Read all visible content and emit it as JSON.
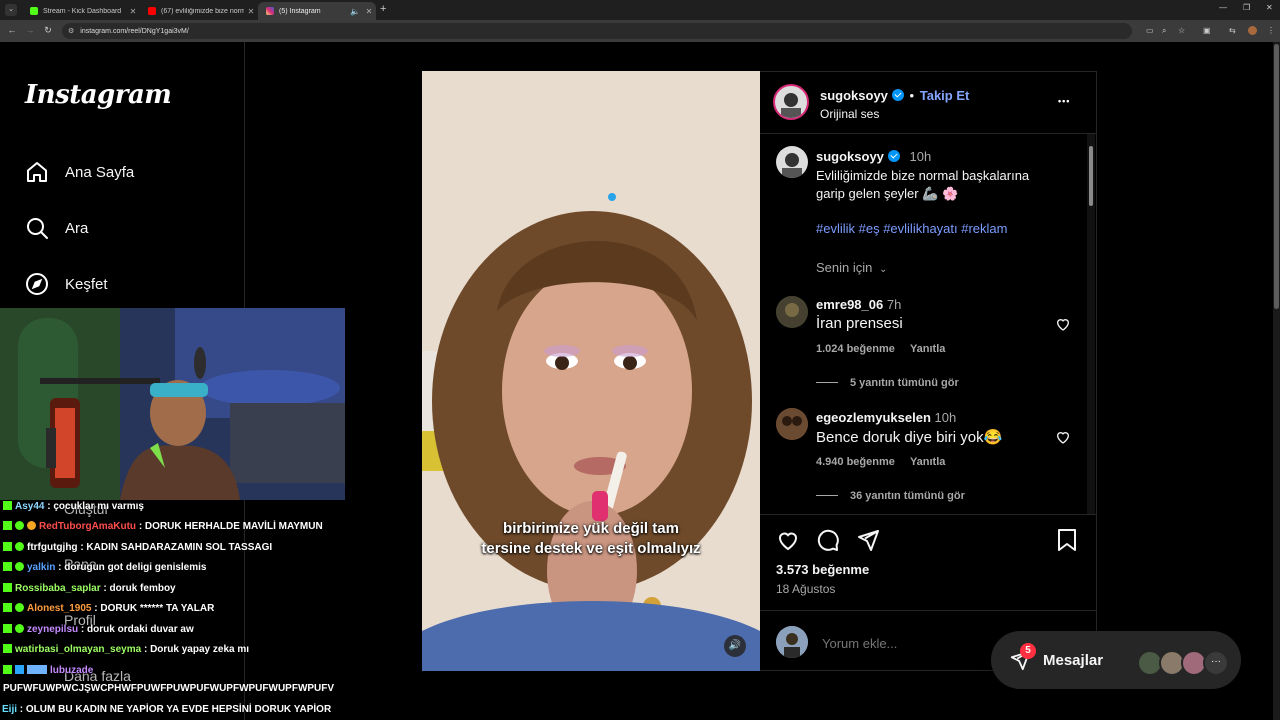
{
  "browser": {
    "tabs": [
      {
        "title": "Stream - Kick Dashboard",
        "color": "#53fc18"
      },
      {
        "title": "(67) evliliğimizde bize normal",
        "color": "#ff0000"
      },
      {
        "title": "(5) Instagram",
        "color": "#e1306c"
      }
    ],
    "url": "instagram.com/reel/DNgY1gai3vM/"
  },
  "sidebar": {
    "logo": "Instagram",
    "items": [
      {
        "label": "Ana Sayfa",
        "icon": "home-icon"
      },
      {
        "label": "Ara",
        "icon": "search-icon"
      },
      {
        "label": "Keşfet",
        "icon": "compass-icon"
      }
    ],
    "ghost_items": [
      "Oluştur",
      "Pano",
      "Profil",
      "Daha fazla"
    ]
  },
  "chat": [
    {
      "user": "Asy44",
      "msg": ": çocuklar mı varmış",
      "color": "#8fd7ff"
    },
    {
      "user": "RedTuborgAmaKutu",
      "msg": ": DORUK HERHALDE MAVİLİ MAYMUN",
      "color": "#ff4d4d"
    },
    {
      "user": "ftrfgutgjhg",
      "msg": ": KADIN SAHDARAZAMIN SOL TASSAGI",
      "color": "#ffffff"
    },
    {
      "user": "yalkin",
      "msg": ": dorugun got deligi genislemis",
      "color": "#5aa0ff"
    },
    {
      "user": "Rossibaba_saplar",
      "msg": ": doruk femboy",
      "color": "#9cff63"
    },
    {
      "user": "Alonest_1905",
      "msg": ": DORUK ****** TA YALAR",
      "color": "#ff9d3d"
    },
    {
      "user": "zeynepilsu",
      "msg": ": doruk ordaki duvar aw",
      "color": "#c58bff"
    },
    {
      "user": "watirbasi_olmayan_seyma",
      "msg": ": Doruk yapay zeka mı",
      "color": "#9cff63"
    },
    {
      "user": "lubuzade",
      "msg": "",
      "color": "#c58bff"
    },
    {
      "user": "",
      "msg": "PUFWFUWPWCJŞWCPHWFPUWFPUWPUFWUPFWPUFWUPFWPUFV",
      "color": "#ffffff"
    },
    {
      "user": "Eiji",
      "msg": ": OLUM BU KADIN NE YAPİOR YA EVDE HEPSİNİ DORUK YAPİOR",
      "color": "#66e0ff"
    }
  ],
  "video": {
    "caption_line1": "birbirimize yük değil tam",
    "caption_line2": "tersine destek ve eşit olmalıyız"
  },
  "post": {
    "author": "sugoksoyy",
    "follow": "Takip Et",
    "separator": "•",
    "audio": "Orijinal ses",
    "more": "•••",
    "time": "10h",
    "caption_line1": "Evliliğimizde bize normal başkalarına",
    "caption_line2": "garip gelen şeyler 🦾 🌸",
    "hashtags": "#evlilik #eş #evlilikhayatı #reklam",
    "for_you": "Senin için",
    "comments": [
      {
        "user": "emre98_06",
        "time": "7h",
        "text": "İran prensesi",
        "likes": "1.024 beğenme",
        "reply": "Yanıtla",
        "view_replies": "5 yanıtın tümünü gör"
      },
      {
        "user": "egeozlemyukselen",
        "time": "10h",
        "text": "Bence doruk diye biri yok😂",
        "likes": "4.940 beğenme",
        "reply": "Yanıtla",
        "view_replies": "36 yanıtın tümünü gör"
      }
    ],
    "likes": "3.573 beğenme",
    "date": "18 Ağustos",
    "comment_placeholder": "Yorum ekle..."
  },
  "messages": {
    "label": "Mesajlar",
    "badge": "5"
  }
}
